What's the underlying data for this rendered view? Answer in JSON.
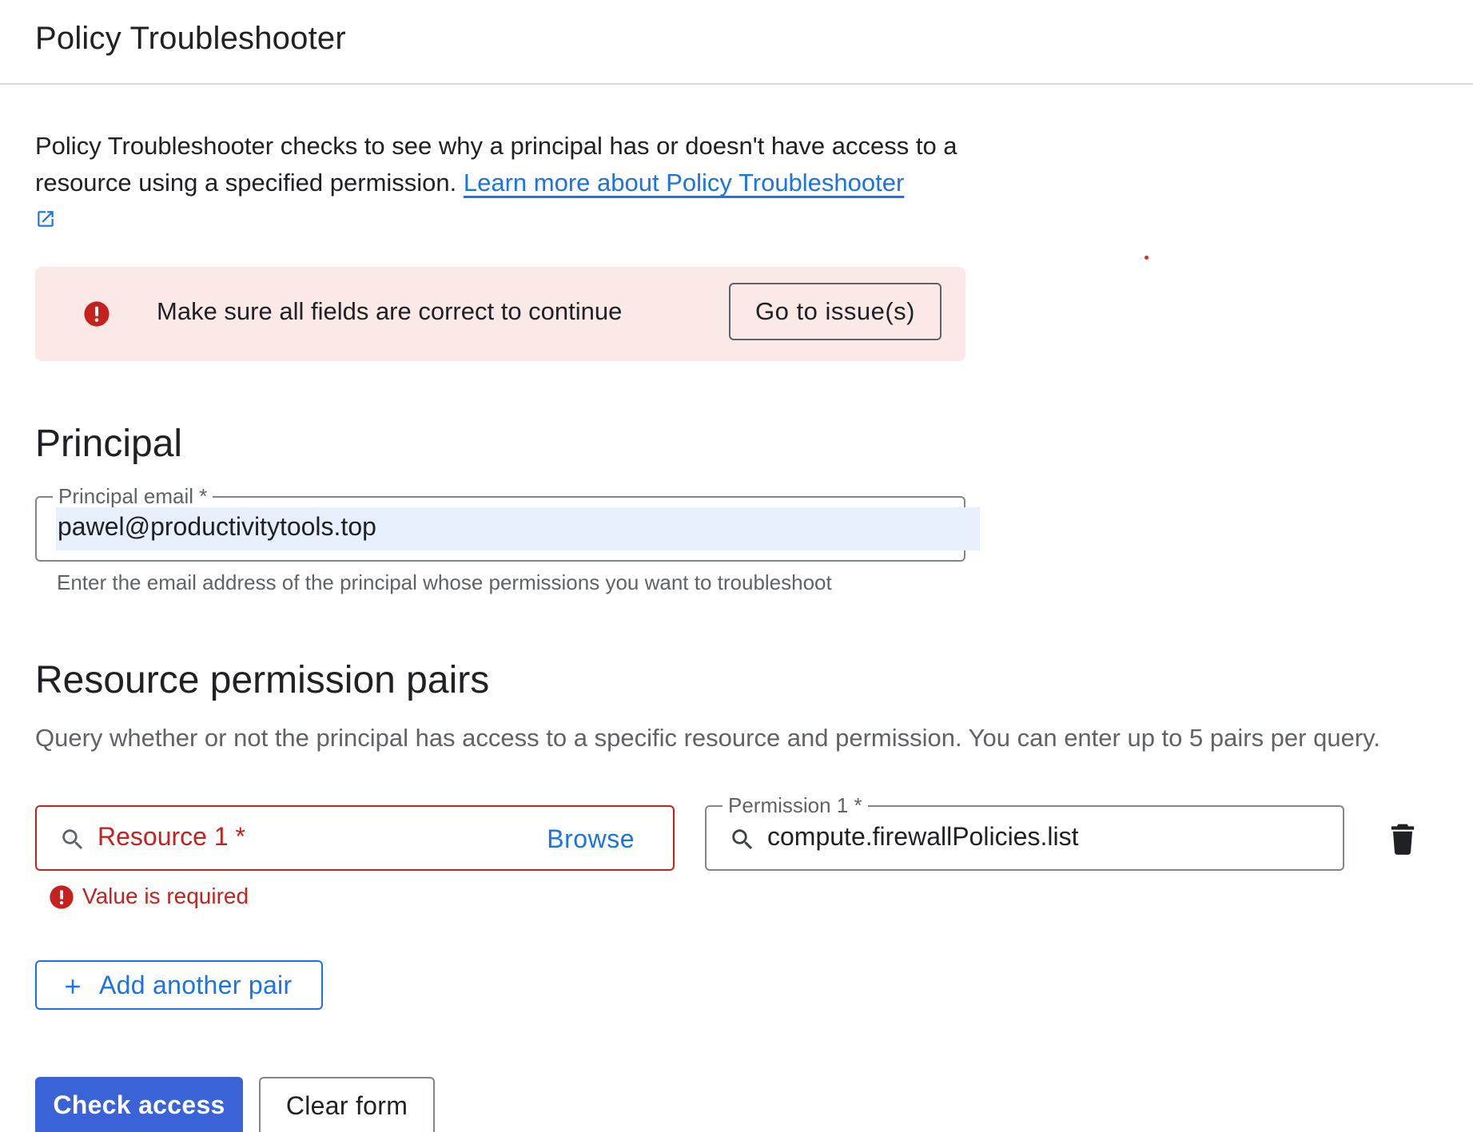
{
  "header": {
    "title": "Policy Troubleshooter"
  },
  "intro": {
    "text": "Policy Troubleshooter checks to see why a principal has or doesn't have access to a resource using a specified permission.",
    "link_text": "Learn more about Policy Troubleshooter",
    "link_icon": "external-link-icon"
  },
  "alert": {
    "icon": "error-icon",
    "message": "Make sure all fields are correct to continue",
    "button_label": "Go to issue(s)"
  },
  "principal": {
    "title": "Principal",
    "email_label": "Principal email *",
    "email_value": "pawel@productivitytools.top",
    "helper_text": "Enter the email address of the principal whose permissions you want to troubleshoot"
  },
  "pairs": {
    "title": "Resource permission pairs",
    "description": "Query whether or not the principal has access to a specific resource and permission. You can enter up to 5 pairs per query.",
    "resource": {
      "label": "Resource 1 *",
      "browse_label": "Browse",
      "error": "Value is required",
      "icon": "search-icon"
    },
    "permission": {
      "label": "Permission 1 *",
      "value": "compute.firewallPolicies.list",
      "icon": "search-icon"
    },
    "delete_icon": "trash-icon",
    "add_button": "Add another pair"
  },
  "actions": {
    "check_access": "Check access",
    "clear_form": "Clear form"
  },
  "colors": {
    "primary": "#1a73e8",
    "primary_button": "#3b63d8",
    "error": "#c5221f",
    "alert_bg": "#fbe9e7",
    "highlight": "#e8f0fe"
  }
}
